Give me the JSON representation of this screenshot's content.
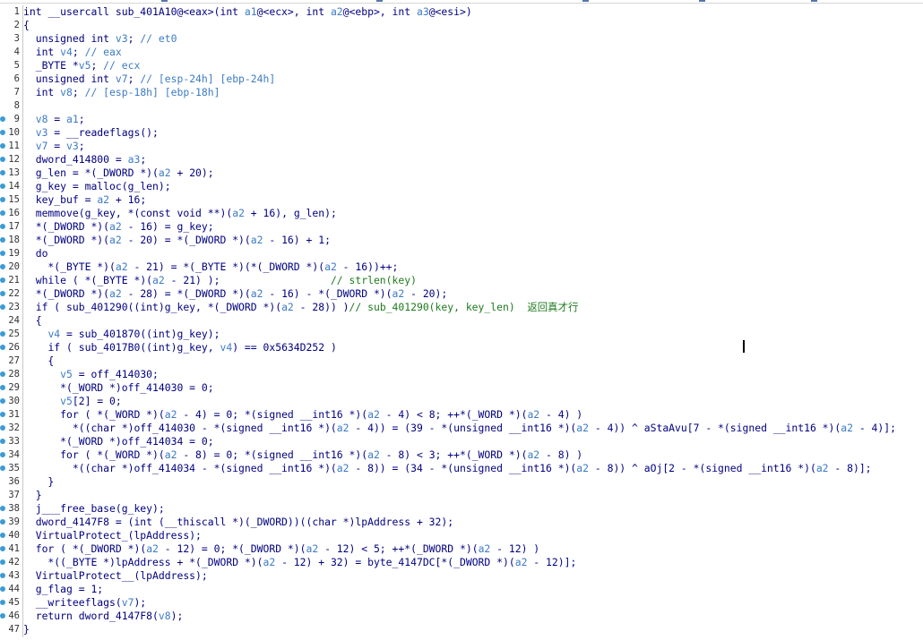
{
  "editor": {
    "lines": [
      "int __usercall sub_401A10@<eax>(int a1@<ecx>, int a2@<ebp>, int a3@<esi>)",
      "{",
      "  unsigned int v3; // et0",
      "  int v4; // eax",
      "  _BYTE *v5; // ecx",
      "  unsigned int v7; // [esp-24h] [ebp-24h]",
      "  int v8; // [esp-18h] [ebp-18h]",
      "",
      "  v8 = a1;",
      "  v3 = __readeflags();",
      "  v7 = v3;",
      "  dword_414800 = a3;",
      "  g_len = *(_DWORD *)(a2 + 20);",
      "  g_key = malloc(g_len);",
      "  key_buf = a2 + 16;",
      "  memmove(g_key, *(const void **)(a2 + 16), g_len);",
      "  *(_DWORD *)(a2 - 16) = g_key;",
      "  *(_DWORD *)(a2 - 20) = *(_DWORD *)(a2 - 16) + 1;",
      "  do",
      "    *(_BYTE *)(a2 - 21) = *(_BYTE *)(*(_DWORD *)(a2 - 16))++;",
      "  while ( *(_BYTE *)(a2 - 21) );                  // strlen(key)",
      "  *(_DWORD *)(a2 - 28) = *(_DWORD *)(a2 - 16) - *(_DWORD *)(a2 - 20);",
      "  if ( sub_401290((int)g_key, *(_DWORD *)(a2 - 28)) )// sub_401290(key, key_len)  返回真才行",
      "  {",
      "    v4 = sub_401870((int)g_key);",
      "    if ( sub_4017B0((int)g_key, v4) == 0x5634D252 )",
      "    {",
      "      v5 = off_414030;",
      "      *(_WORD *)off_414030 = 0;",
      "      v5[2] = 0;",
      "      for ( *(_WORD *)(a2 - 4) = 0; *(signed __int16 *)(a2 - 4) < 8; ++*(_WORD *)(a2 - 4) )",
      "        *((char *)off_414030 - *(signed __int16 *)(a2 - 4)) = (39 - *(unsigned __int16 *)(a2 - 4)) ^ aStaAvu[7 - *(signed __int16 *)(a2 - 4)];",
      "      *(_WORD *)off_414034 = 0;",
      "      for ( *(_WORD *)(a2 - 8) = 0; *(signed __int16 *)(a2 - 8) < 3; ++*(_WORD *)(a2 - 8) )",
      "        *((char *)off_414034 - *(signed __int16 *)(a2 - 8)) = (34 - *(unsigned __int16 *)(a2 - 8)) ^ aOj[2 - *(signed __int16 *)(a2 - 8)];",
      "    }",
      "  }",
      "  j___free_base(g_key);",
      "  dword_4147F8 = (int (__thiscall *)(_DWORD))((char *)lpAddress + 32);",
      "  VirtualProtect_(lpAddress);",
      "  for ( *(_DWORD *)(a2 - 12) = 0; *(_DWORD *)(a2 - 12) < 5; ++*(_DWORD *)(a2 - 12) )",
      "    *((_BYTE *)lpAddress + *(_DWORD *)(a2 - 12) + 32) = byte_4147DC[*(_DWORD *)(a2 - 12)];",
      "  VirtualProtect__(lpAddress);",
      "  g_flag = 1;",
      "  __writeeflags(v7);",
      "  return dword_4147F8(v8);",
      "}"
    ],
    "breakpoint_lines": [
      9,
      10,
      11,
      12,
      13,
      14,
      15,
      16,
      17,
      18,
      19,
      20,
      21,
      22,
      23,
      25,
      26,
      28,
      29,
      30,
      31,
      32,
      33,
      34,
      35,
      38,
      39,
      40,
      41,
      42,
      43,
      44,
      45,
      46
    ],
    "cursor_line": 26
  },
  "colors": {
    "code": "#000080",
    "local_var": "#3d7bc4",
    "comment": "#1d7a1d",
    "breakpoint_dot": "#3d9bd4",
    "line_number": "#333333"
  }
}
